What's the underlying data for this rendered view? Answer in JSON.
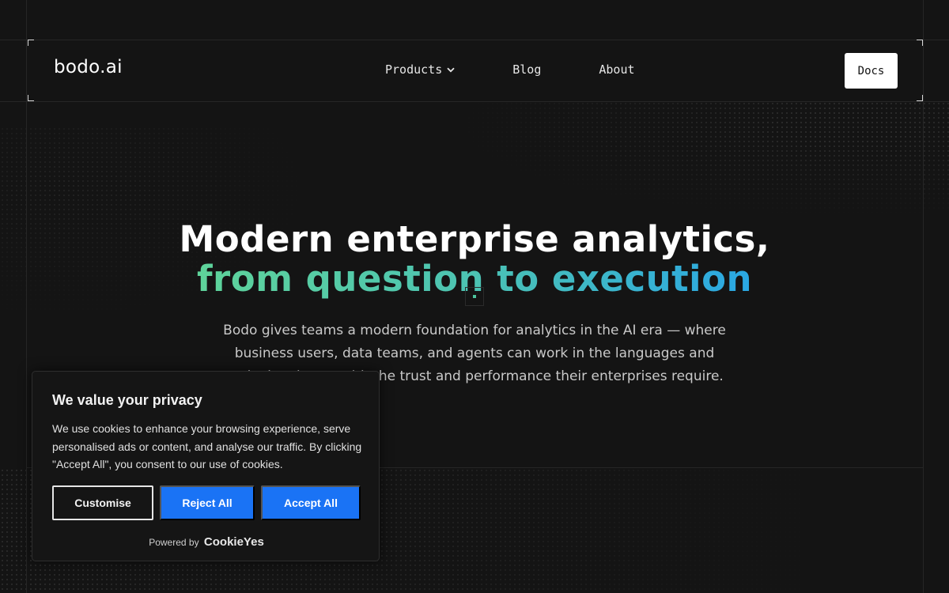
{
  "nav": {
    "logo": "bodo.ai",
    "links": [
      {
        "label": "Products",
        "has_dropdown": true
      },
      {
        "label": "Blog"
      },
      {
        "label": "About"
      }
    ],
    "docs_label": "Docs"
  },
  "hero": {
    "title_line1": "Modern enterprise analytics,",
    "title_line2": "from question to execution",
    "description": "Bodo gives teams a modern foundation for analytics in the AI era — where business users, data teams, and agents can work in the languages and tools they know, with the trust and performance their enterprises require."
  },
  "cookie_banner": {
    "title": "We value your privacy",
    "text": "We use cookies to enhance your browsing experience, serve personalised ads or content, and analyse our traffic. By clicking \"Accept All\", you consent to our use of cookies.",
    "customise_label": "Customise",
    "reject_label": "Reject All",
    "accept_label": "Accept All",
    "powered_by": "Powered by",
    "powered_brand": "CookieYes"
  },
  "colors": {
    "background": "#141414",
    "gradient_start": "#5ed39a",
    "gradient_end": "#2aa7e4",
    "button_blue": "#1a73f5"
  }
}
